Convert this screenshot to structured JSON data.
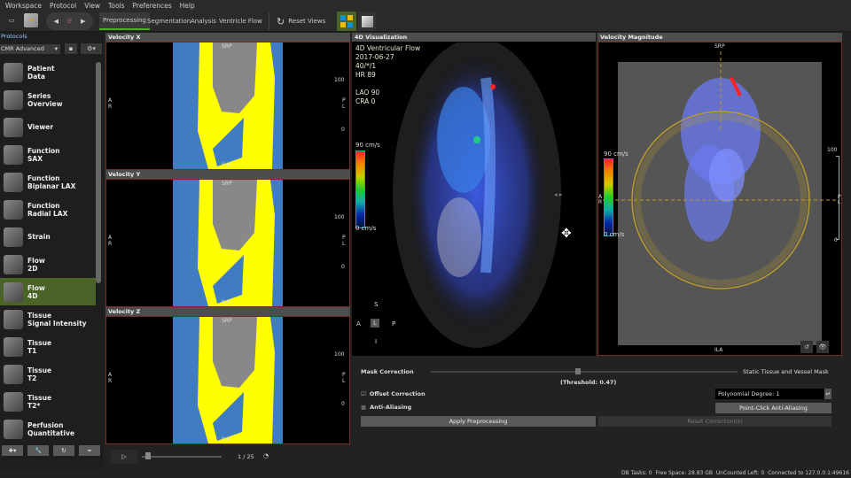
{
  "menu": [
    "Workspace",
    "Protocol",
    "View",
    "Tools",
    "Preferences",
    "Help"
  ],
  "toolbar": {
    "tabs": [
      "Preprocessing",
      "Segmentation",
      "Analysis",
      "Ventricle Flow"
    ],
    "reset_views": "Reset Views"
  },
  "protocols": {
    "label": "Protocols",
    "selected": "CMR Advanced",
    "items": [
      "Patient\nData",
      "Series\nOverview",
      "Viewer",
      "Function\nSAX",
      "Function\nBiplanar LAX",
      "Function\nRadial LAX",
      "Strain",
      "Flow\n2D",
      "Flow\n4D",
      "Tissue\nSignal Intensity",
      "Tissue\nT1",
      "Tissue\nT2",
      "Tissue\nT2*",
      "Perfusion\nQuantitative"
    ],
    "active_index": 8
  },
  "panels": {
    "velocity_x": "Velocity X",
    "velocity_y": "Velocity Y",
    "velocity_z": "Velocity Z",
    "viz4d": "4D Visualization",
    "magnitude": "Velocity Magnitude"
  },
  "orient": {
    "top": "SRP",
    "bottom": "ILA",
    "left": "A\nR",
    "right": "P\nL",
    "scale_max": "100",
    "scale_min": "0"
  },
  "viz_info": [
    "4D Ventricular Flow",
    "2017-06-27",
    "40/*/1",
    "HR 89",
    "",
    "LAO 90",
    "CRA 0"
  ],
  "colorbar": {
    "max": "90 cm/s",
    "min": "0 cm/s"
  },
  "cube": {
    "S": "S",
    "I": "I",
    "A": "A",
    "P": "P",
    "L": "L"
  },
  "playback": {
    "frame": "1 / 25",
    "progress": 0.04
  },
  "controls": {
    "mask_label": "Mask Correction",
    "mask_value_label": "Static Tissue and Vessel Mask",
    "threshold": "(Threshold: 0.47)",
    "threshold_value": 0.47,
    "offset": "Offset Correction",
    "offset_checked": true,
    "anti_aliasing": "Anti-Aliasing",
    "anti_checked": false,
    "poly": "Polynomial Degree: 1",
    "point_click": "Point-Click Anti-Aliasing",
    "apply": "Apply Preprocessing",
    "reset": "Reset Correction(s)"
  },
  "status": "DB Tasks: 0  Free Space: 28.83 GB  UnCounted Left: 0  Connected to 127.0.0.1:49616"
}
